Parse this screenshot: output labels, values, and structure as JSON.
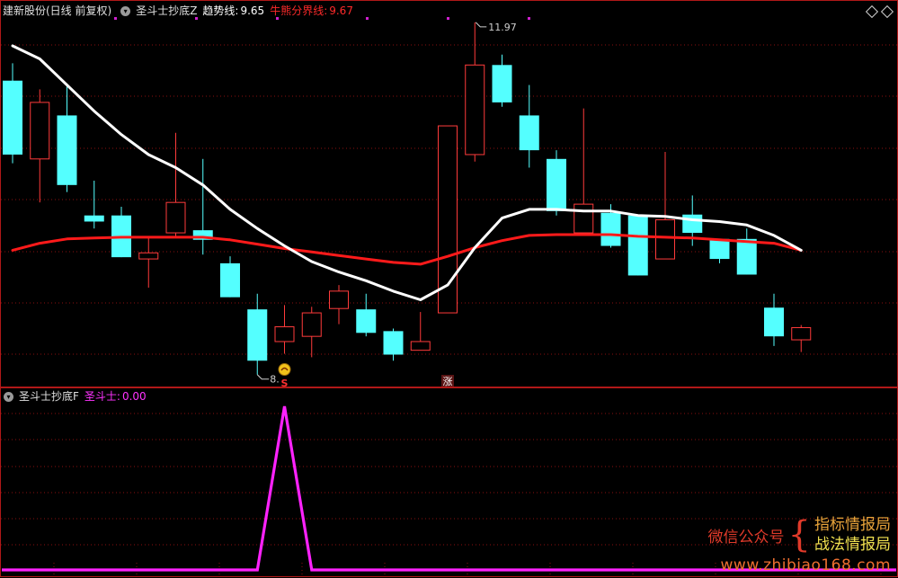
{
  "top_panel": {
    "stock_title": "建新股份(日线 前复权)",
    "indicator_name": "圣斗士抄底Z",
    "trend_label": "趋势线:",
    "trend_value": "9.65",
    "bull_bear_label": "牛熊分界线:",
    "bull_bear_value": "9.67",
    "high_marker": "11.97",
    "low_marker": "8.",
    "signal_s": "S",
    "signal_zhang": "涨"
  },
  "bottom_panel": {
    "indicator_name": "圣斗士抄底F",
    "line_label": "圣斗士:",
    "line_value": "0.00"
  },
  "watermark": {
    "lead": "微信公众号",
    "line1": "指标情报局",
    "line2": "战法情报局",
    "site": "www.zhibiao168.com"
  },
  "colors": {
    "up": "#ff3b3b",
    "down": "#54ffff",
    "trend_line": "#ffffff",
    "bull_bear_line": "#ff1a1a",
    "signal_line": "#ff22ff",
    "grid": "#8a1010",
    "panel_border": "#b01818"
  },
  "icons": [
    "chevron-down-icon",
    "settings-diamond-icon",
    "smile-signal-icon"
  ],
  "chart_data": {
    "type": "candlestick",
    "price_range_visible": [
      7.95,
      12.4
    ],
    "high_marker_value": 11.97,
    "candles": [
      {
        "o": 11.3,
        "c": 10.45,
        "h": 11.5,
        "l": 10.35
      },
      {
        "o": 10.4,
        "c": 11.05,
        "h": 11.2,
        "l": 9.9
      },
      {
        "o": 10.9,
        "c": 10.1,
        "h": 11.25,
        "l": 10.02
      },
      {
        "o": 9.75,
        "c": 9.68,
        "h": 10.15,
        "l": 9.6
      },
      {
        "o": 9.75,
        "c": 9.27,
        "h": 9.85,
        "l": 9.27
      },
      {
        "o": 9.25,
        "c": 9.32,
        "h": 9.5,
        "l": 8.92
      },
      {
        "o": 9.55,
        "c": 9.9,
        "h": 10.7,
        "l": 9.5
      },
      {
        "o": 9.58,
        "c": 9.47,
        "h": 10.4,
        "l": 9.3
      },
      {
        "o": 9.2,
        "c": 8.81,
        "h": 9.28,
        "l": 8.81
      },
      {
        "o": 8.67,
        "c": 8.08,
        "h": 8.85,
        "l": 7.92
      },
      {
        "o": 8.3,
        "c": 8.47,
        "h": 8.72,
        "l": 8.16
      },
      {
        "o": 8.36,
        "c": 8.63,
        "h": 8.7,
        "l": 8.12
      },
      {
        "o": 8.68,
        "c": 8.88,
        "h": 8.95,
        "l": 8.5
      },
      {
        "o": 8.67,
        "c": 8.4,
        "h": 8.85,
        "l": 8.36
      },
      {
        "o": 8.42,
        "c": 8.15,
        "h": 8.45,
        "l": 8.08
      },
      {
        "o": 8.2,
        "c": 8.3,
        "h": 8.64,
        "l": 8.2
      },
      {
        "o": 8.63,
        "c": 10.78,
        "h": 10.78,
        "l": 8.63
      },
      {
        "o": 10.45,
        "c": 11.48,
        "h": 11.97,
        "l": 10.37
      },
      {
        "o": 11.48,
        "c": 11.05,
        "h": 11.6,
        "l": 11.0
      },
      {
        "o": 10.9,
        "c": 10.5,
        "h": 11.25,
        "l": 10.3
      },
      {
        "o": 10.4,
        "c": 9.8,
        "h": 10.5,
        "l": 9.75
      },
      {
        "o": 9.55,
        "c": 9.88,
        "h": 10.98,
        "l": 9.55
      },
      {
        "o": 9.78,
        "c": 9.4,
        "h": 9.88,
        "l": 9.38
      },
      {
        "o": 9.75,
        "c": 9.06,
        "h": 9.75,
        "l": 9.06
      },
      {
        "o": 9.25,
        "c": 9.7,
        "h": 10.48,
        "l": 9.25
      },
      {
        "o": 9.76,
        "c": 9.55,
        "h": 9.98,
        "l": 9.4
      },
      {
        "o": 9.48,
        "c": 9.25,
        "h": 9.48,
        "l": 9.2
      },
      {
        "o": 9.48,
        "c": 9.07,
        "h": 9.6,
        "l": 9.07
      },
      {
        "o": 8.69,
        "c": 8.36,
        "h": 8.85,
        "l": 8.25
      },
      {
        "o": 8.32,
        "c": 8.46,
        "h": 8.49,
        "l": 8.18
      }
    ],
    "trend_line": [
      11.7,
      11.55,
      11.25,
      10.95,
      10.68,
      10.45,
      10.3,
      10.1,
      9.82,
      9.6,
      9.4,
      9.22,
      9.1,
      9.0,
      8.88,
      8.78,
      8.95,
      9.38,
      9.72,
      9.82,
      9.82,
      9.8,
      9.8,
      9.75,
      9.74,
      9.7,
      9.68,
      9.64,
      9.52,
      9.35
    ],
    "bull_bear_line": [
      9.35,
      9.43,
      9.48,
      9.49,
      9.5,
      9.5,
      9.5,
      9.5,
      9.47,
      9.42,
      9.37,
      9.33,
      9.29,
      9.25,
      9.21,
      9.19,
      9.28,
      9.38,
      9.46,
      9.52,
      9.53,
      9.53,
      9.53,
      9.51,
      9.5,
      9.49,
      9.47,
      9.45,
      9.43,
      9.35
    ],
    "signal_series": [
      0,
      0,
      0,
      0,
      0,
      0,
      0,
      0,
      0,
      0,
      1,
      0,
      0,
      0,
      0,
      0,
      0,
      0,
      0,
      0,
      0,
      0,
      0,
      0,
      0,
      0,
      0,
      0,
      0,
      0
    ],
    "signal_range": [
      0,
      1
    ]
  }
}
